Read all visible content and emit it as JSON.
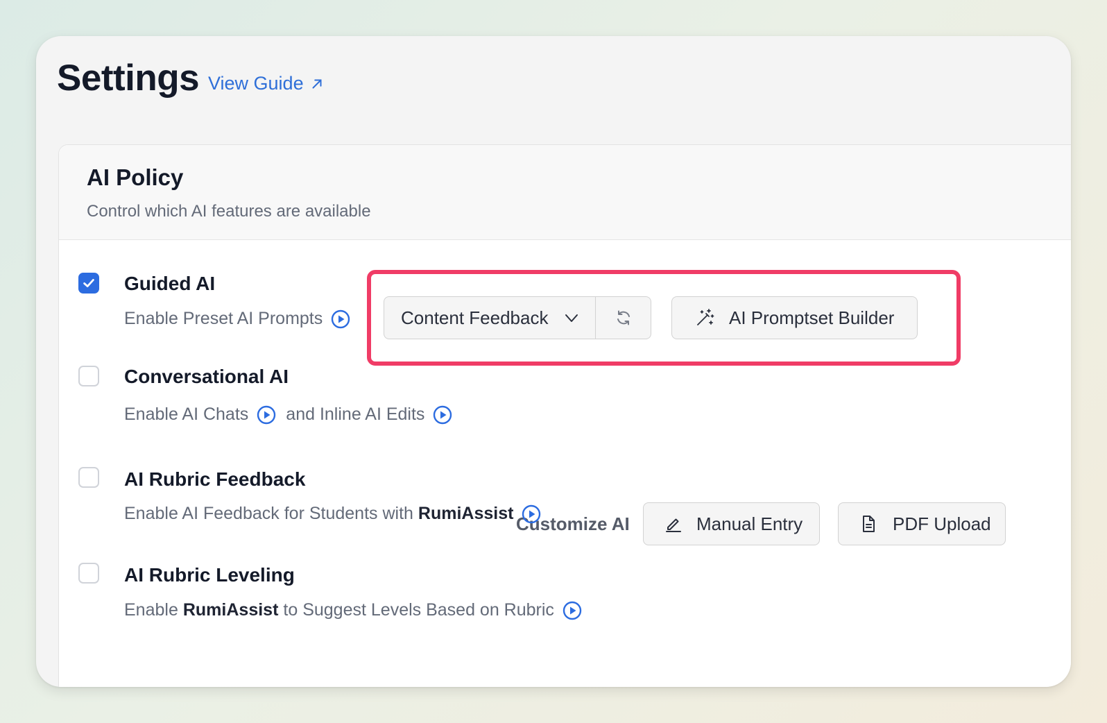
{
  "header": {
    "title": "Settings",
    "guide_link": "View Guide"
  },
  "policy": {
    "title": "AI Policy",
    "subtitle": "Control which AI features are available"
  },
  "options": {
    "guided": {
      "title": "Guided AI",
      "checked": true,
      "desc": "Enable Preset AI Prompts",
      "dropdown_value": "Content Feedback",
      "builder_label": "AI Promptset Builder"
    },
    "conversational": {
      "title": "Conversational AI",
      "checked": false,
      "desc_part1": "Enable AI Chats",
      "desc_part2": "and Inline AI Edits",
      "customize_label": "Customize AI",
      "manual_label": "Manual Entry",
      "pdf_label": "PDF Upload"
    },
    "rubric_feedback": {
      "title": "AI Rubric Feedback",
      "checked": false,
      "desc_prefix": "Enable AI Feedback for Students with",
      "desc_brand": "RumiAssist"
    },
    "rubric_leveling": {
      "title": "AI Rubric Leveling",
      "checked": false,
      "desc_prefix": "Enable",
      "desc_brand": "RumiAssist",
      "desc_suffix": "to Suggest Levels Based on Rubric"
    }
  },
  "colors": {
    "accent": "#2c6ce0",
    "link": "#2f6fd8",
    "highlight": "#f03c66"
  }
}
